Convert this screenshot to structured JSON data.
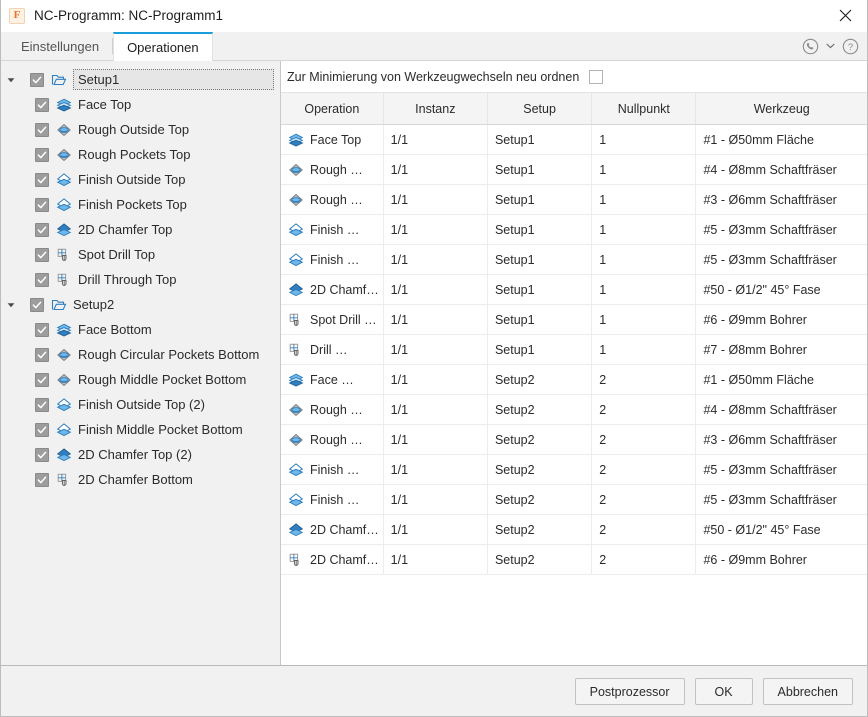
{
  "window": {
    "app_icon": "fusion-f-icon",
    "title": "NC-Programm: NC-Programm1",
    "close_label": "✕"
  },
  "tabs": [
    {
      "label": "Einstellungen",
      "active": false
    },
    {
      "label": "Operationen",
      "active": true
    }
  ],
  "header_icons": {
    "support": "phone-support-icon",
    "chevron": "chevron-down-icon",
    "help": "help-question-icon"
  },
  "tree": {
    "nodes": [
      {
        "label": "Setup1",
        "icon": "setup-folder-icon",
        "level": 0,
        "checked": true,
        "expanded": true,
        "editing": true
      },
      {
        "label": "Face Top",
        "icon": "face-icon",
        "level": 1,
        "checked": true
      },
      {
        "label": "Rough Outside Top",
        "icon": "adaptive-rough-icon",
        "level": 1,
        "checked": true
      },
      {
        "label": "Rough Pockets Top",
        "icon": "adaptive-rough-icon",
        "level": 1,
        "checked": true
      },
      {
        "label": "Finish Outside Top",
        "icon": "contour-finish-icon",
        "level": 1,
        "checked": true
      },
      {
        "label": "Finish Pockets Top",
        "icon": "contour-finish-icon",
        "level": 1,
        "checked": true
      },
      {
        "label": "2D Chamfer Top",
        "icon": "chamfer-icon",
        "level": 1,
        "checked": true
      },
      {
        "label": "Spot Drill Top",
        "icon": "drill-icon",
        "level": 1,
        "checked": true
      },
      {
        "label": "Drill Through Top",
        "icon": "drill-icon",
        "level": 1,
        "checked": true
      },
      {
        "label": "Setup2",
        "icon": "setup-folder-icon",
        "level": 0,
        "checked": true,
        "expanded": true
      },
      {
        "label": "Face Bottom",
        "icon": "face-icon",
        "level": 1,
        "checked": true
      },
      {
        "label": "Rough Circular Pockets Bottom",
        "icon": "adaptive-rough-icon",
        "level": 1,
        "checked": true
      },
      {
        "label": "Rough Middle Pocket Bottom",
        "icon": "adaptive-rough-icon",
        "level": 1,
        "checked": true
      },
      {
        "label": "Finish Outside Top (2)",
        "icon": "contour-finish-icon",
        "level": 1,
        "checked": true
      },
      {
        "label": "Finish Middle Pocket Bottom",
        "icon": "contour-finish-icon",
        "level": 1,
        "checked": true
      },
      {
        "label": "2D Chamfer Top (2)",
        "icon": "chamfer-icon",
        "level": 1,
        "checked": true
      },
      {
        "label": "2D Chamfer Bottom",
        "icon": "drill-icon",
        "level": 1,
        "checked": true
      }
    ]
  },
  "reorder": {
    "label": "Zur Minimierung von Werkzeugwechseln neu ordnen",
    "checked": false
  },
  "table": {
    "columns": [
      "Operation",
      "Instanz",
      "Setup",
      "Nullpunkt",
      "Werkzeug"
    ],
    "rows": [
      {
        "icon": "face-icon",
        "operation": "Face Top",
        "instanz": "1/1",
        "setup": "Setup1",
        "nullpunkt": "1",
        "werkzeug": "#1 - Ø50mm Fläche"
      },
      {
        "icon": "adaptive-rough-icon",
        "operation": "Rough …",
        "instanz": "1/1",
        "setup": "Setup1",
        "nullpunkt": "1",
        "werkzeug": "#4 - Ø8mm Schaftfräser"
      },
      {
        "icon": "adaptive-rough-icon",
        "operation": "Rough …",
        "instanz": "1/1",
        "setup": "Setup1",
        "nullpunkt": "1",
        "werkzeug": "#3 - Ø6mm Schaftfräser"
      },
      {
        "icon": "contour-finish-icon",
        "operation": "Finish …",
        "instanz": "1/1",
        "setup": "Setup1",
        "nullpunkt": "1",
        "werkzeug": "#5 - Ø3mm Schaftfräser"
      },
      {
        "icon": "contour-finish-icon",
        "operation": "Finish …",
        "instanz": "1/1",
        "setup": "Setup1",
        "nullpunkt": "1",
        "werkzeug": "#5 - Ø3mm Schaftfräser"
      },
      {
        "icon": "chamfer-icon",
        "operation": "2D Chamfe…",
        "instanz": "1/1",
        "setup": "Setup1",
        "nullpunkt": "1",
        "werkzeug": "#50 - Ø1/2\" 45° Fase"
      },
      {
        "icon": "drill-icon",
        "operation": "Spot Drill …",
        "instanz": "1/1",
        "setup": "Setup1",
        "nullpunkt": "1",
        "werkzeug": "#6 - Ø9mm Bohrer"
      },
      {
        "icon": "drill-icon",
        "operation": "Drill …",
        "instanz": "1/1",
        "setup": "Setup1",
        "nullpunkt": "1",
        "werkzeug": "#7 - Ø8mm Bohrer"
      },
      {
        "icon": "face-icon",
        "operation": "Face …",
        "instanz": "1/1",
        "setup": "Setup2",
        "nullpunkt": "2",
        "werkzeug": "#1 - Ø50mm Fläche"
      },
      {
        "icon": "adaptive-rough-icon",
        "operation": "Rough …",
        "instanz": "1/1",
        "setup": "Setup2",
        "nullpunkt": "2",
        "werkzeug": "#4 - Ø8mm Schaftfräser"
      },
      {
        "icon": "adaptive-rough-icon",
        "operation": "Rough …",
        "instanz": "1/1",
        "setup": "Setup2",
        "nullpunkt": "2",
        "werkzeug": "#3 - Ø6mm Schaftfräser"
      },
      {
        "icon": "contour-finish-icon",
        "operation": "Finish …",
        "instanz": "1/1",
        "setup": "Setup2",
        "nullpunkt": "2",
        "werkzeug": "#5 - Ø3mm Schaftfräser"
      },
      {
        "icon": "contour-finish-icon",
        "operation": "Finish …",
        "instanz": "1/1",
        "setup": "Setup2",
        "nullpunkt": "2",
        "werkzeug": "#5 - Ø3mm Schaftfräser"
      },
      {
        "icon": "chamfer-icon",
        "operation": "2D Chamfe…",
        "instanz": "1/1",
        "setup": "Setup2",
        "nullpunkt": "2",
        "werkzeug": "#50 - Ø1/2\" 45° Fase"
      },
      {
        "icon": "drill-icon",
        "operation": "2D Chamfe…",
        "instanz": "1/1",
        "setup": "Setup2",
        "nullpunkt": "2",
        "werkzeug": "#6 - Ø9mm Bohrer"
      }
    ]
  },
  "footer": {
    "postprocessor": "Postprozessor",
    "ok": "OK",
    "cancel": "Abbrechen"
  },
  "colors": {
    "accent": "#1a9ed9",
    "icon_blue": "#2f7fc1",
    "icon_light_blue": "#55aee8",
    "brand_orange": "#e8752a",
    "window_bg": "#f1f1f1"
  }
}
